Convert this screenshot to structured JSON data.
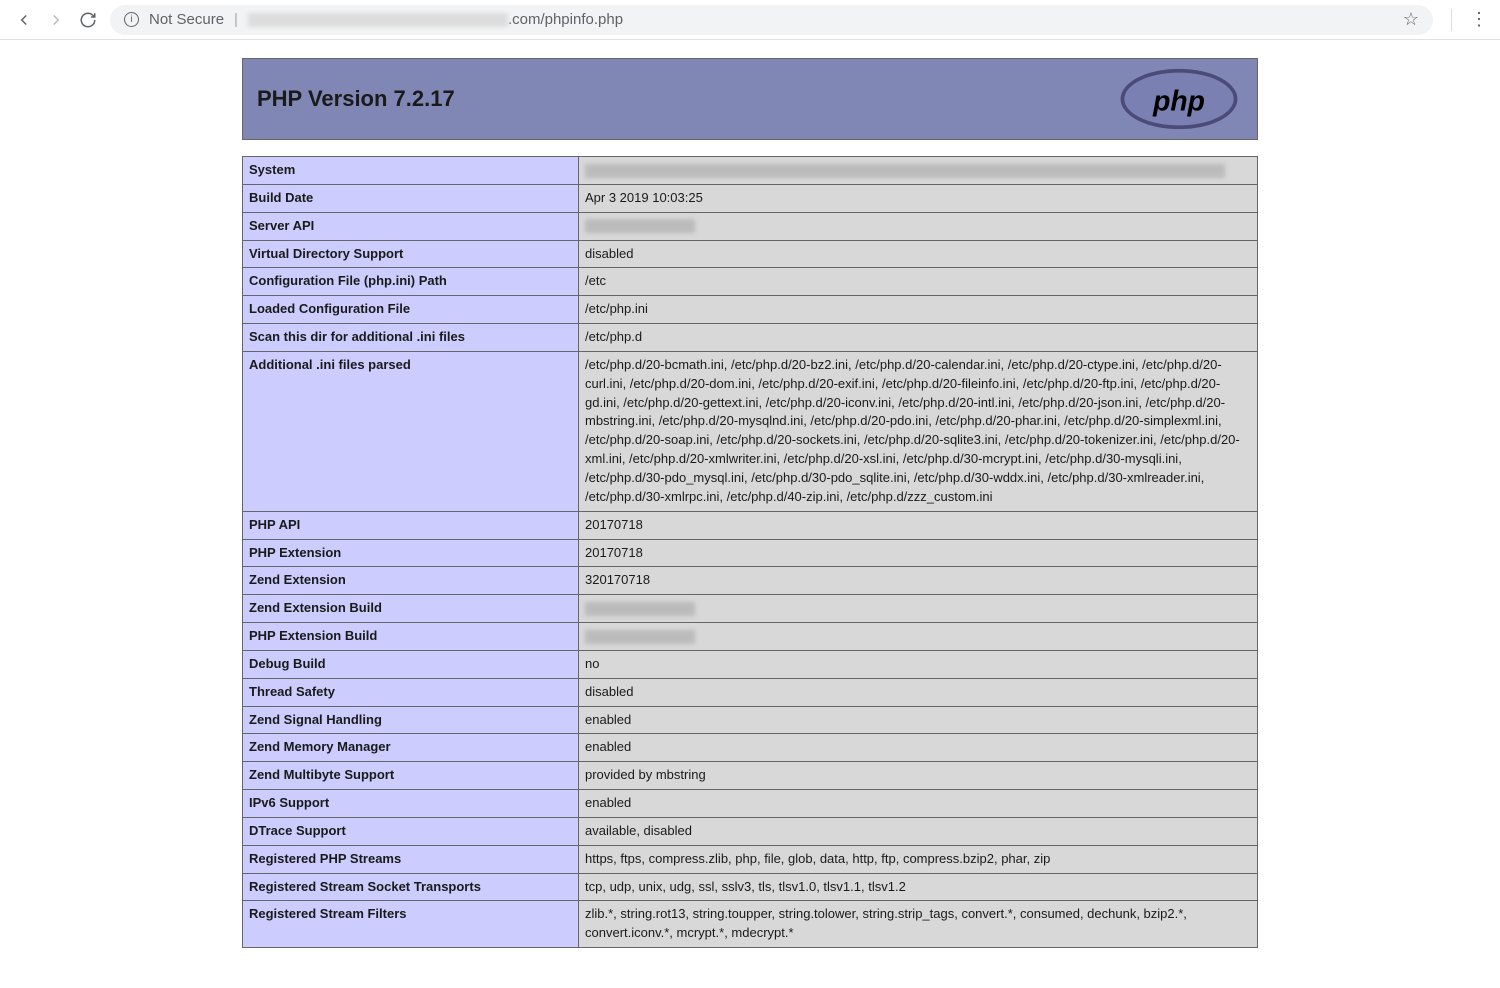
{
  "browser": {
    "not_secure": "Not Secure",
    "url_suffix": ".com/phpinfo.php"
  },
  "header": {
    "title": "PHP Version 7.2.17"
  },
  "rows": [
    {
      "label": "System",
      "value": "",
      "blurred": true,
      "blur_class": "wide"
    },
    {
      "label": "Build Date",
      "value": "Apr 3 2019 10:03:25"
    },
    {
      "label": "Server API",
      "value": "",
      "blurred": true,
      "blur_class": "med"
    },
    {
      "label": "Virtual Directory Support",
      "value": "disabled"
    },
    {
      "label": "Configuration File (php.ini) Path",
      "value": "/etc"
    },
    {
      "label": "Loaded Configuration File",
      "value": "/etc/php.ini"
    },
    {
      "label": "Scan this dir for additional .ini files",
      "value": "/etc/php.d"
    },
    {
      "label": "Additional .ini files parsed",
      "value": "/etc/php.d/20-bcmath.ini, /etc/php.d/20-bz2.ini, /etc/php.d/20-calendar.ini, /etc/php.d/20-ctype.ini, /etc/php.d/20-curl.ini, /etc/php.d/20-dom.ini, /etc/php.d/20-exif.ini, /etc/php.d/20-fileinfo.ini, /etc/php.d/20-ftp.ini, /etc/php.d/20-gd.ini, /etc/php.d/20-gettext.ini, /etc/php.d/20-iconv.ini, /etc/php.d/20-intl.ini, /etc/php.d/20-json.ini, /etc/php.d/20-mbstring.ini, /etc/php.d/20-mysqlnd.ini, /etc/php.d/20-pdo.ini, /etc/php.d/20-phar.ini, /etc/php.d/20-simplexml.ini, /etc/php.d/20-soap.ini, /etc/php.d/20-sockets.ini, /etc/php.d/20-sqlite3.ini, /etc/php.d/20-tokenizer.ini, /etc/php.d/20-xml.ini, /etc/php.d/20-xmlwriter.ini, /etc/php.d/20-xsl.ini, /etc/php.d/30-mcrypt.ini, /etc/php.d/30-mysqli.ini, /etc/php.d/30-pdo_mysql.ini, /etc/php.d/30-pdo_sqlite.ini, /etc/php.d/30-wddx.ini, /etc/php.d/30-xmlreader.ini, /etc/php.d/30-xmlrpc.ini, /etc/php.d/40-zip.ini, /etc/php.d/zzz_custom.ini"
    },
    {
      "label": "PHP API",
      "value": "20170718"
    },
    {
      "label": "PHP Extension",
      "value": "20170718"
    },
    {
      "label": "Zend Extension",
      "value": "320170718"
    },
    {
      "label": "Zend Extension Build",
      "value": "",
      "blurred": true,
      "blur_class": "med"
    },
    {
      "label": "PHP Extension Build",
      "value": "",
      "blurred": true,
      "blur_class": "med"
    },
    {
      "label": "Debug Build",
      "value": "no"
    },
    {
      "label": "Thread Safety",
      "value": "disabled"
    },
    {
      "label": "Zend Signal Handling",
      "value": "enabled"
    },
    {
      "label": "Zend Memory Manager",
      "value": "enabled"
    },
    {
      "label": "Zend Multibyte Support",
      "value": "provided by mbstring"
    },
    {
      "label": "IPv6 Support",
      "value": "enabled"
    },
    {
      "label": "DTrace Support",
      "value": "available, disabled"
    },
    {
      "label": "Registered PHP Streams",
      "value": "https, ftps, compress.zlib, php, file, glob, data, http, ftp, compress.bzip2, phar, zip"
    },
    {
      "label": "Registered Stream Socket Transports",
      "value": "tcp, udp, unix, udg, ssl, sslv3, tls, tlsv1.0, tlsv1.1, tlsv1.2"
    },
    {
      "label": "Registered Stream Filters",
      "value": "zlib.*, string.rot13, string.toupper, string.tolower, string.strip_tags, convert.*, consumed, dechunk, bzip2.*, convert.iconv.*, mcrypt.*, mdecrypt.*"
    }
  ]
}
